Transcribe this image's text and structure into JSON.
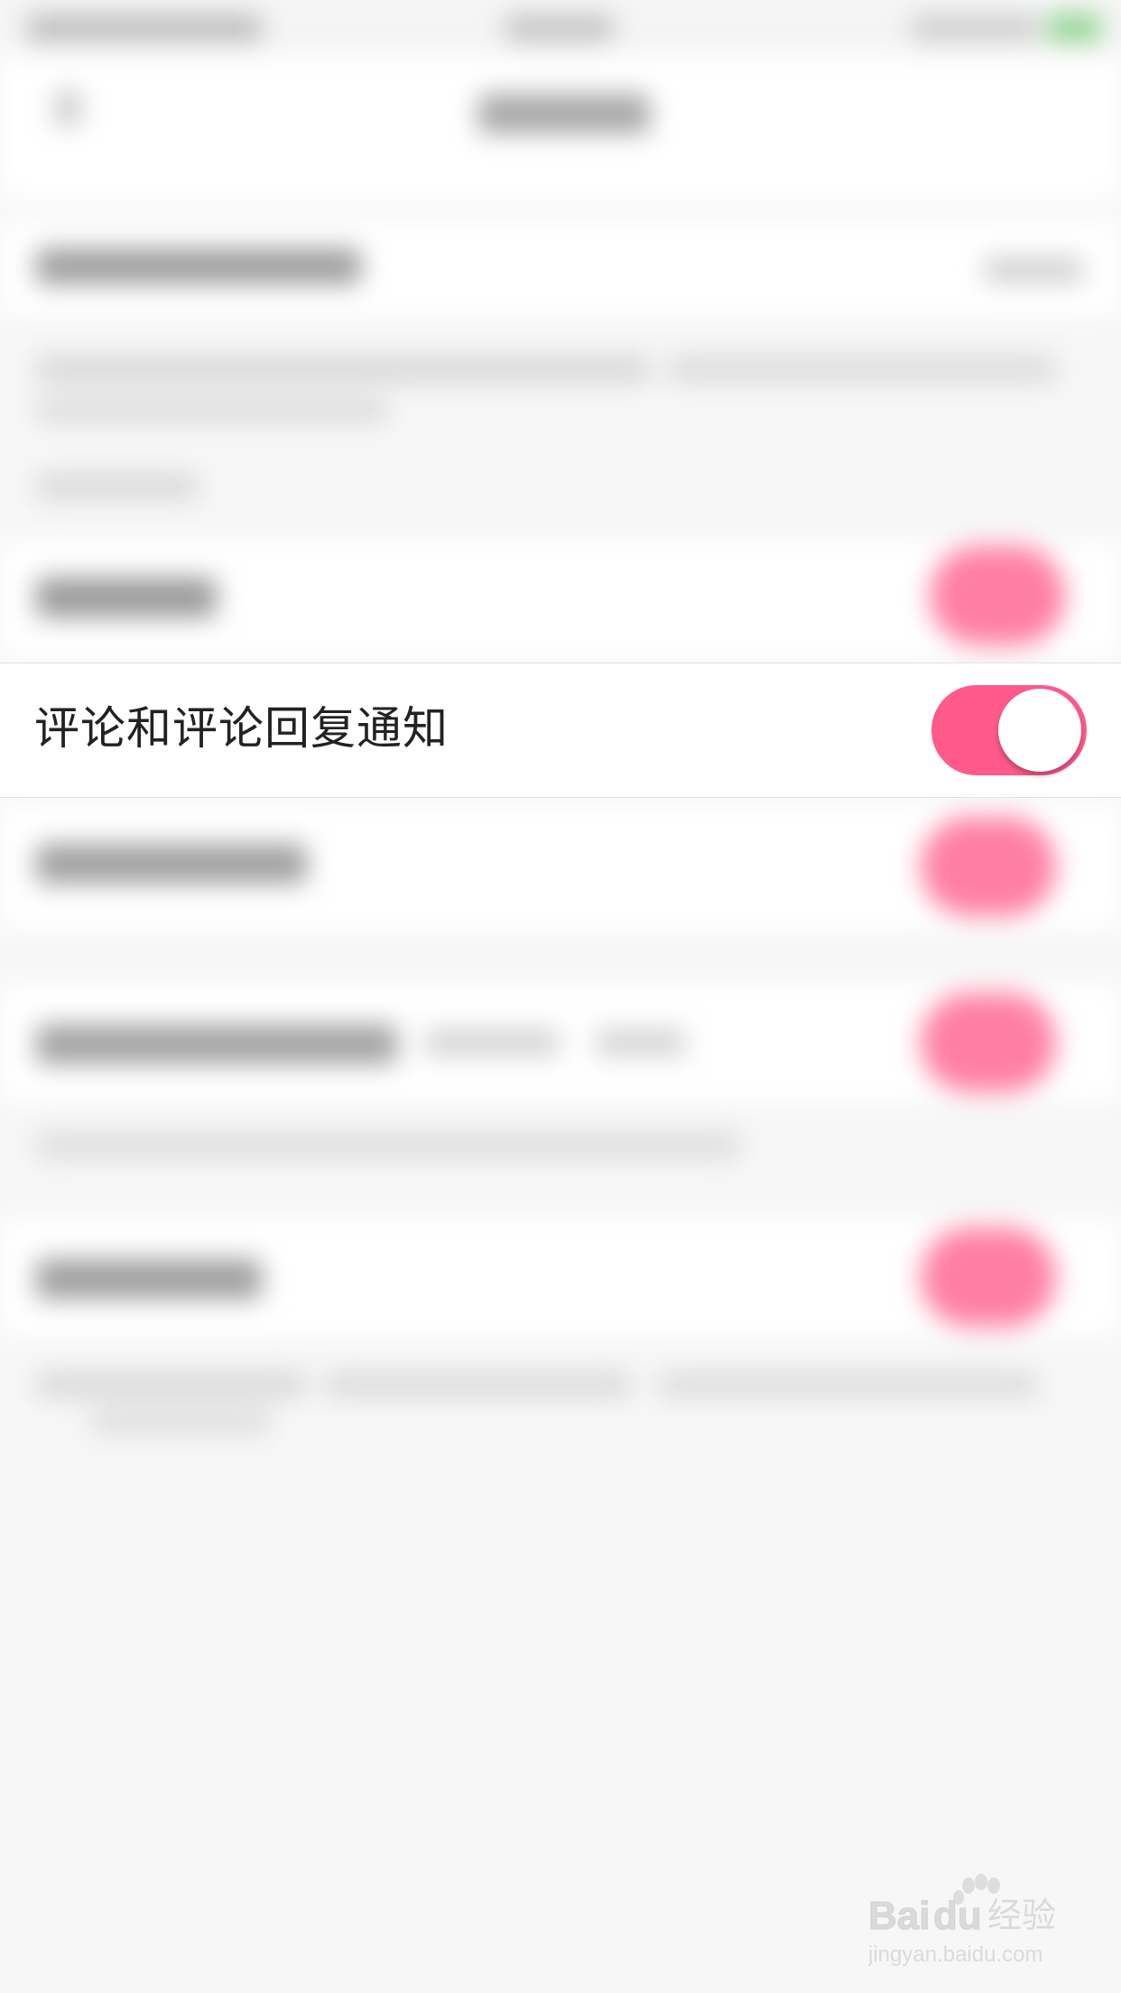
{
  "setting": {
    "label": "评论和评论回复通知",
    "enabled": true
  },
  "colors": {
    "toggle_on": "#ff5a8a",
    "background": "#f7f7f7",
    "row": "#ffffff"
  },
  "watermark": {
    "brand": "Baidu经验",
    "url": "jingyan.baidu.com"
  }
}
